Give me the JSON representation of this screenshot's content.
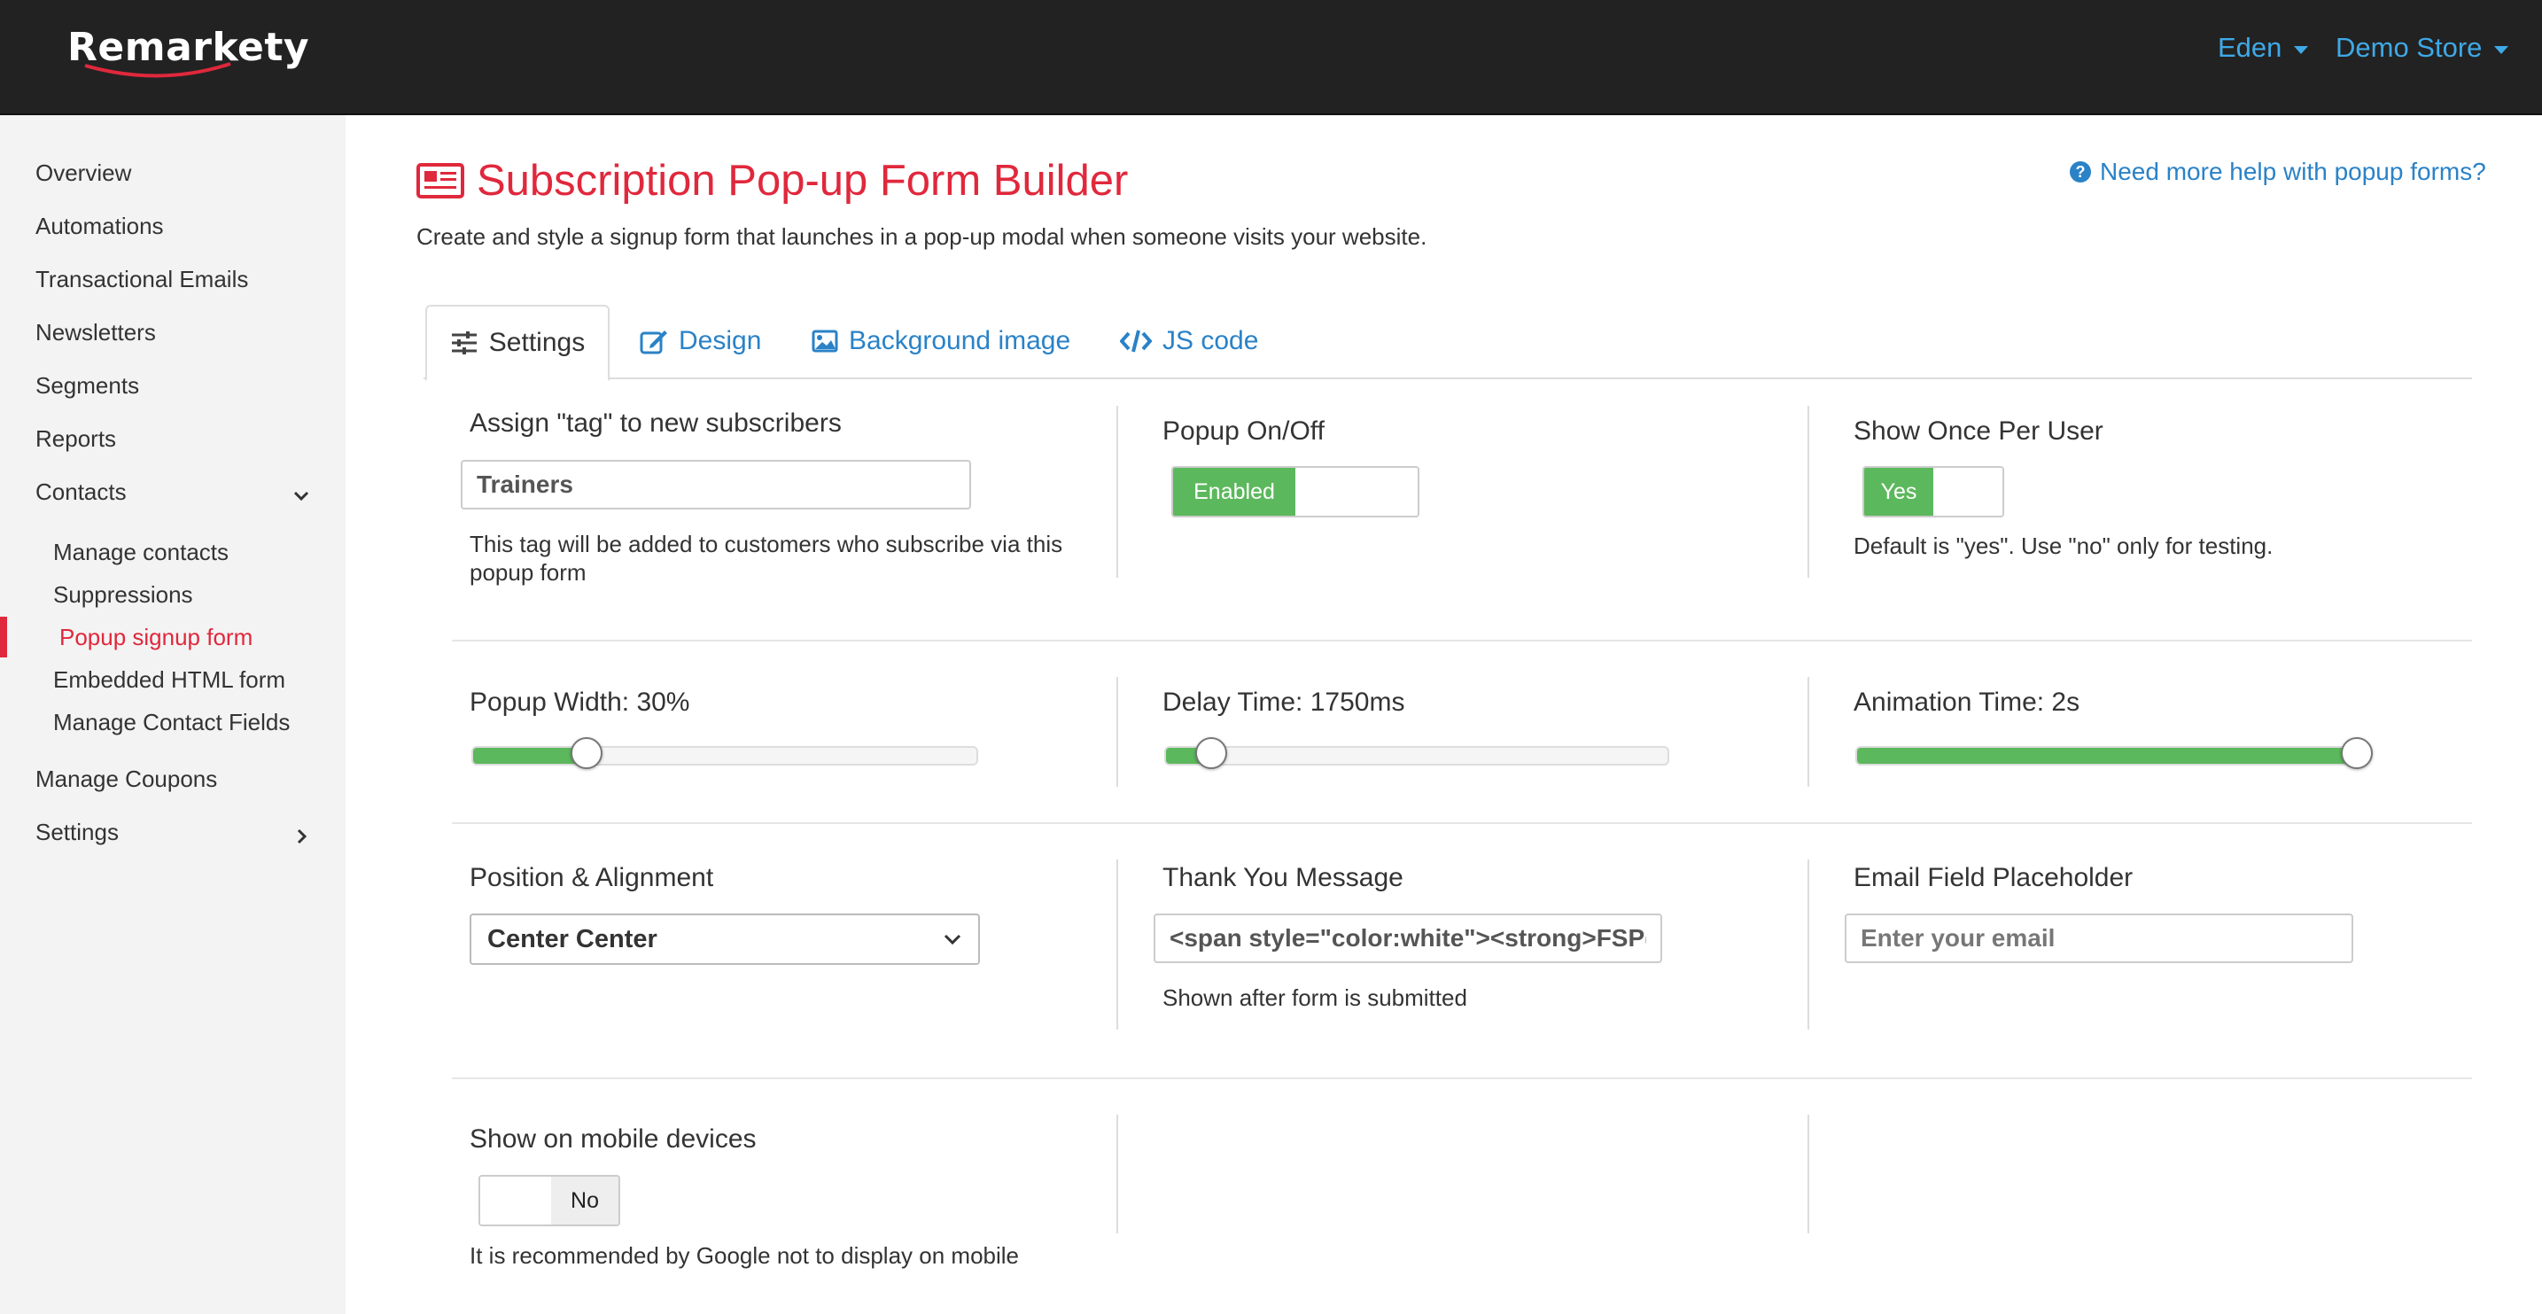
{
  "header": {
    "logo_text": "Remarkety",
    "user_menu": "Eden",
    "store_menu": "Demo Store"
  },
  "sidebar": {
    "items": [
      {
        "label": "Overview"
      },
      {
        "label": "Automations"
      },
      {
        "label": "Transactional Emails"
      },
      {
        "label": "Newsletters"
      },
      {
        "label": "Segments"
      },
      {
        "label": "Reports"
      },
      {
        "label": "Contacts"
      },
      {
        "label": "Manage Coupons"
      },
      {
        "label": "Settings"
      }
    ],
    "contacts_sub": [
      {
        "label": "Manage contacts"
      },
      {
        "label": "Suppressions"
      },
      {
        "label": "Popup signup form"
      },
      {
        "label": "Embedded HTML form"
      },
      {
        "label": "Manage Contact Fields"
      }
    ],
    "active_color": "#e0283c"
  },
  "main": {
    "title": "Subscription Pop-up Form Builder",
    "subtitle": "Create and style a signup form that launches in a pop-up modal when someone visits your website.",
    "help_link": "Need more help with popup forms?",
    "tabs": [
      {
        "label": "Settings",
        "icon": "sliders-icon"
      },
      {
        "label": "Design",
        "icon": "edit-icon"
      },
      {
        "label": "Background image",
        "icon": "image-icon"
      },
      {
        "label": "JS code",
        "icon": "code-icon"
      }
    ],
    "tag": {
      "label": "Assign \"tag\" to new subscribers",
      "value": "Trainers",
      "help": "This tag will be added to customers who subscribe via this popup form"
    },
    "popup_toggle": {
      "label": "Popup On/Off",
      "state": "Enabled"
    },
    "show_once": {
      "label": "Show Once Per User",
      "state": "Yes",
      "help": "Default is \"yes\". Use \"no\" only for testing."
    },
    "popup_width": {
      "label": "Popup Width: 30%",
      "fraction": 0.225
    },
    "delay_time": {
      "label": "Delay Time: 1750ms",
      "fraction": 0.09
    },
    "animation_time": {
      "label": "Animation Time: 2s",
      "fraction": 1.0
    },
    "position": {
      "label": "Position & Alignment",
      "selected": "Center Center"
    },
    "thank_you": {
      "label": "Thank You Message",
      "value": "<span style=\"color:white\"><strong>FSP(",
      "help": "Shown after form is submitted"
    },
    "email_placeholder": {
      "label": "Email Field Placeholder",
      "placeholder": "Enter your email"
    },
    "mobile": {
      "label": "Show on mobile devices",
      "state": "No",
      "help": "It is recommended by Google not to display on mobile"
    }
  },
  "colors": {
    "accent_red": "#e0283c",
    "link_blue": "#2a82c7",
    "toggle_green": "#5cb85c"
  }
}
